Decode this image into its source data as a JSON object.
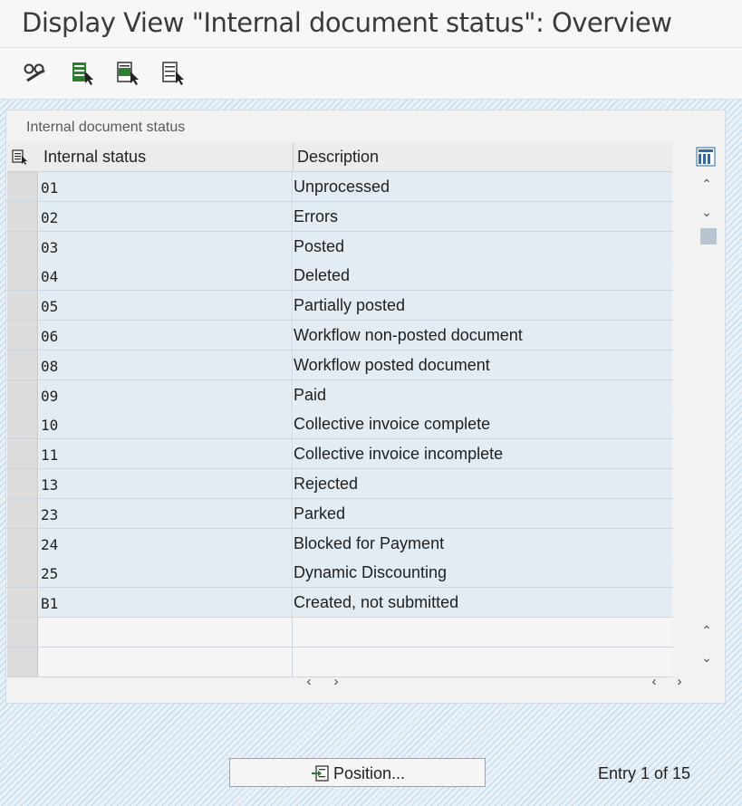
{
  "window": {
    "title": "Display View \"Internal document status\": Overview"
  },
  "toolbar": {
    "buttons": [
      {
        "icon": "glasses-pencil-icon",
        "tooltip": "Display/Change"
      },
      {
        "icon": "select-all-icon",
        "tooltip": "Select All"
      },
      {
        "icon": "select-block-icon",
        "tooltip": "Select Block"
      },
      {
        "icon": "deselect-all-icon",
        "tooltip": "Deselect All"
      }
    ]
  },
  "table": {
    "caption": "Internal document status",
    "columns": [
      "Internal status",
      "Description"
    ],
    "rows": [
      {
        "status": "01",
        "description": "Unprocessed"
      },
      {
        "status": "02",
        "description": "Errors"
      },
      {
        "status": "03",
        "description": "Posted"
      },
      {
        "status": "04",
        "description": "Deleted"
      },
      {
        "status": "05",
        "description": "Partially posted"
      },
      {
        "status": "06",
        "description": "Workflow non-posted document"
      },
      {
        "status": "08",
        "description": "Workflow posted document"
      },
      {
        "status": "09",
        "description": "Paid"
      },
      {
        "status": "10",
        "description": "Collective invoice complete"
      },
      {
        "status": "11",
        "description": "Collective invoice incomplete"
      },
      {
        "status": "13",
        "description": "Rejected"
      },
      {
        "status": "23",
        "description": "Parked"
      },
      {
        "status": "24",
        "description": "Blocked for Payment"
      },
      {
        "status": "25",
        "description": "Dynamic Discounting"
      },
      {
        "status": "B1",
        "description": "Created, not submitted"
      }
    ],
    "empty_rows": 2
  },
  "footer": {
    "position_button": "Position...",
    "entry_text": "Entry 1 of 15"
  },
  "colors": {
    "row_bg": "#e4ecf3",
    "header_bg": "#ececec",
    "hatch": "#8cb4d7"
  }
}
